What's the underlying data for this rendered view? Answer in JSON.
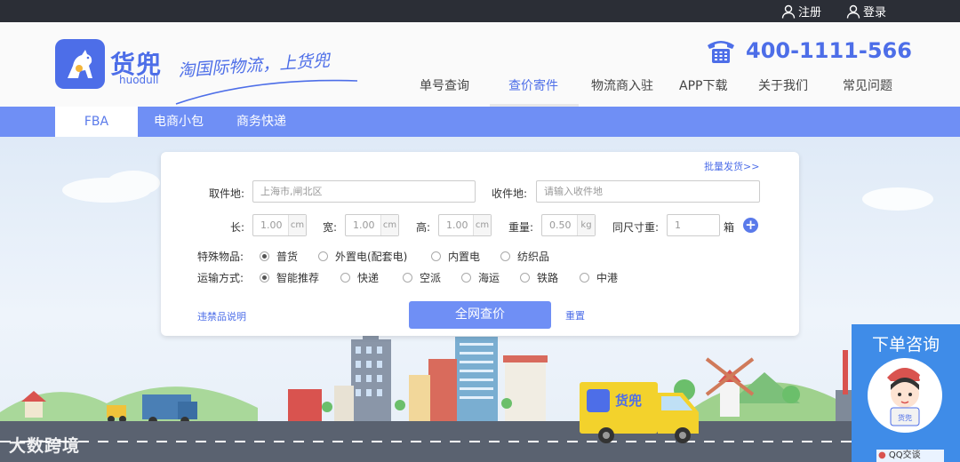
{
  "topbar": {
    "register": "注册",
    "login": "登录"
  },
  "logo": {
    "cn": "货兜",
    "en": "huodull",
    "slogan": "淘国际物流，上货兜"
  },
  "hotline": "400-1111-566",
  "nav": [
    "单号查询",
    "查价寄件",
    "物流商入驻",
    "APP下载",
    "关于我们",
    "常见问题"
  ],
  "tabs": [
    "FBA",
    "电商小包",
    "商务快递"
  ],
  "form": {
    "bulk_link": "批量发货>>",
    "pickup_label": "取件地:",
    "pickup_value": "上海市,闸北区",
    "recv_label": "收件地:",
    "recv_placeholder": "请输入收件地",
    "length_label": "长:",
    "length_value": "1.00",
    "width_label": "宽:",
    "width_value": "1.00",
    "height_label": "高:",
    "height_value": "1.00",
    "unit_cm": "cm",
    "weight_label": "重量:",
    "weight_value": "0.50",
    "unit_kg": "kg",
    "same_size_label": "同尺寸重:",
    "same_size_value": "1",
    "box_unit": "箱",
    "special_label": "特殊物品:",
    "special_options": [
      "普货",
      "外置电(配套电)",
      "内置电",
      "纺织品"
    ],
    "transport_label": "运输方式:",
    "transport_options": [
      "智能推荐",
      "快递",
      "空派",
      "海运",
      "铁路",
      "中港"
    ],
    "prohibited_link": "违禁品说明",
    "query_button": "全网查价",
    "reset_link": "重置"
  },
  "consult": {
    "title": "下单咨询",
    "qq": "QQ交谈"
  },
  "watermark": "大数跨境",
  "colors": {
    "brand": "#4d6ee8",
    "tabbar": "#6f8ff5",
    "topbar": "#2b2e36",
    "consult": "#3f8ce8",
    "truck": "#f3d22c"
  }
}
